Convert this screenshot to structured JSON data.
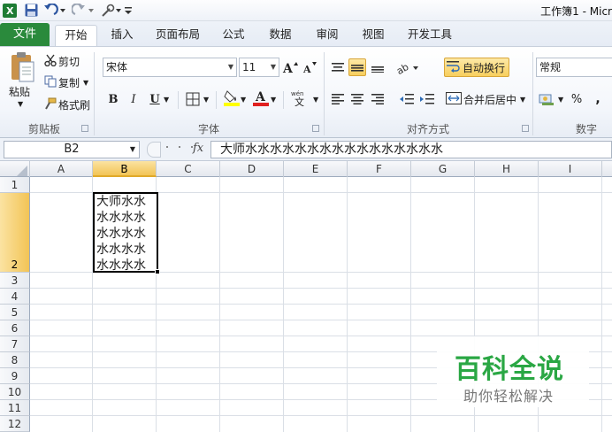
{
  "window": {
    "title": "工作簿1 - Micr"
  },
  "tabs": [
    "文件",
    "开始",
    "插入",
    "页面布局",
    "公式",
    "数据",
    "审阅",
    "视图",
    "开发工具"
  ],
  "clipboard": {
    "paste": "粘贴",
    "cut": "剪切",
    "copy": "复制",
    "format_painter": "格式刷",
    "group": "剪贴板"
  },
  "font": {
    "name": "宋体",
    "size": "11",
    "bold": "B",
    "italic": "I",
    "underline": "U",
    "group": "字体",
    "font_color": "#e02020",
    "fill_color": "#ffff00"
  },
  "alignment": {
    "wrap": "自动换行",
    "merge": "合并后居中",
    "group": "对齐方式"
  },
  "number": {
    "format": "常规",
    "percent": "%",
    "comma": ",",
    "group": "数字"
  },
  "formula_bar": {
    "name_box": "B2",
    "fx": "fx",
    "content": "大师水水水水水水水水水水水水水水水水"
  },
  "columns": [
    "A",
    "B",
    "C",
    "D",
    "E",
    "F",
    "G",
    "H",
    "I"
  ],
  "rows": [
    "1",
    "2",
    "3",
    "4",
    "5",
    "6",
    "7",
    "8",
    "9",
    "10",
    "11",
    "12"
  ],
  "selected": {
    "column": "B",
    "row": "2"
  },
  "cell_b2": {
    "lines": [
      "大师水水",
      "水水水水",
      "水水水水",
      "水水水水",
      "水水水水"
    ]
  },
  "watermark": {
    "title": "百科全说",
    "subtitle": "助你轻松解决"
  },
  "colors": {
    "file_tab": "#2a8a3c",
    "selection_header": "#f2c456",
    "watermark_green": "#2aa744"
  }
}
